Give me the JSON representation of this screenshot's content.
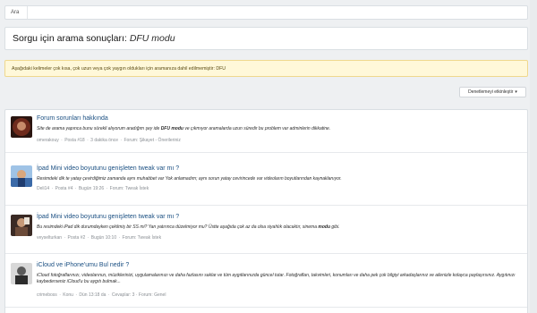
{
  "breadcrumb": {
    "item": "Ara"
  },
  "page": {
    "title_prefix": "Sorgu için arama sonuçları:",
    "query": "DFU modu"
  },
  "notice": {
    "text": "Aşağıdaki kelimeler çok kısa, çok uzun veya çok yaygın oldukları için aramanıza dahil edilmemiştir: DFU"
  },
  "filter": {
    "label": "Denetlemeyi etkinleştir",
    "caret": "▾"
  },
  "results": [
    {
      "title": "Forum sorunları hakkında",
      "snippet_before": "Site de arama yapınca bunu sürekli alıyorum aradığım şey ide ",
      "snippet_bold": "DFU modu",
      "snippet_after": " ve çıkmıyor aramalarda uzun süredir bu problem var adminlerin dikkatine.",
      "author": "omerakouy",
      "post": "Posta #18",
      "time": "3 dakika önce",
      "forum": "Forum: Şikayet - Önerileriniz",
      "avatar_color": "#6e2a1c"
    },
    {
      "title": "İpad Mini video boyutunu genişleten tweak var mı ?",
      "snippet_before": "Resimdeki dik te yatay çevirdiğimiz zamanda aynı muhabbet var Yok anlamadım; aynı sorun yatay cevirincede var videoların boyutlarından kaynaklanıyor.",
      "snippet_bold": "",
      "snippet_after": "",
      "author": "Deli14",
      "post": "Posta #4",
      "time": "Bugün 19:26",
      "forum": "Forum: Tweak İstek",
      "avatar_color": "#3b6aa8"
    },
    {
      "title": "İpad Mini video boyutunu genişleten tweak var mı ?",
      "snippet_before": "Bu resimdeki iPad dik durumdayken çekilmiş bir SS mi? Yan yatırınca düzelmiyor mu? Üstte aşağıda çok az da olsa siyahlık olacaktır, sinema ",
      "snippet_bold": "modu",
      "snippet_after": " gibi.",
      "author": "veyselturkan",
      "post": "Posta #2",
      "time": "Bugün 10:10",
      "forum": "Forum: Tweak İstek",
      "avatar_color": "#5a3a2a"
    },
    {
      "title": "iCloud ve iPhone'umu Bul nedir ?",
      "snippet_before": "iCloud fotoğraflarınızı, videolarınızı, müziklerinizi, uygulamalarınızı ve daha fazlasını saklar ve tüm aygıtlarınızda güncel tutar. Fotoğrafları, takvimleri, konumları ve daha pek çok bilgiyi arkadaşlarınız ve ailenizle kolayca paylaşırsınız. Aygıtınızı kaybederseniz iCloud'u bu aygıtı bulmak...",
      "snippet_bold": "",
      "snippet_after": "",
      "author": "crimeboss",
      "post": "Konu",
      "time": "Dün 13:18 da",
      "forum": "Cevaplar: 3 · Forum: Genel",
      "avatar_color": "#4a4a4a"
    }
  ],
  "sep": "·"
}
